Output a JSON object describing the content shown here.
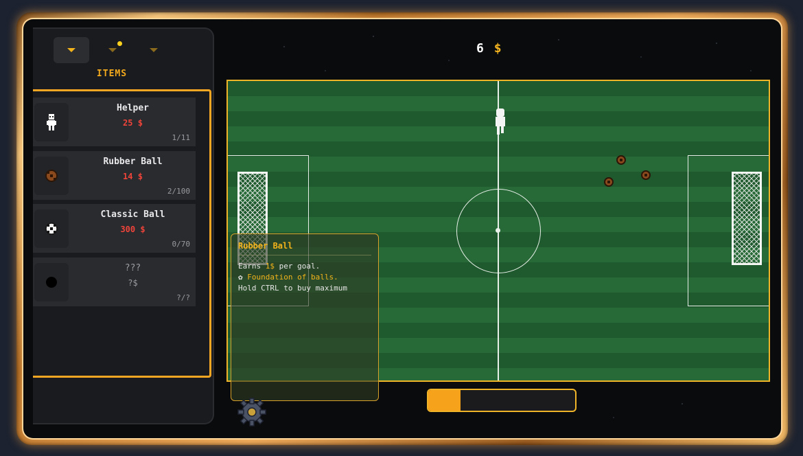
{
  "sidebar": {
    "tab_label": "ITEMS",
    "tabs": [
      {
        "icon": "chevron-icon",
        "active": true,
        "notification": false
      },
      {
        "icon": "chevron-icon",
        "active": false,
        "notification": true
      },
      {
        "icon": "chevron-icon",
        "active": false,
        "notification": false
      }
    ],
    "items": [
      {
        "name": "Helper",
        "price": "25 $",
        "count": "1/11",
        "icon": "helper-figure-icon"
      },
      {
        "name": "Rubber Ball",
        "price": "14 $",
        "count": "2/100",
        "icon": "rubber-ball-icon"
      },
      {
        "name": "Classic Ball",
        "price": "300 $",
        "count": "0/70",
        "icon": "classic-ball-icon"
      },
      {
        "name": "???",
        "price": "?$",
        "count": "?/?",
        "icon": "locked-ball-icon"
      }
    ]
  },
  "money": {
    "amount": "6",
    "currency": "$"
  },
  "tooltip": {
    "title": "Rubber Ball",
    "earns_pre": "Earns ",
    "earns_value": "1$",
    "earns_post": " per goal.",
    "feature": "Foundation of balls.",
    "hint": "Hold CTRL to buy maximum"
  },
  "progress": {
    "fraction": 0.22
  },
  "colors": {
    "accent": "#f5a623",
    "price": "#f0443a",
    "field": "#1f5a2e"
  }
}
